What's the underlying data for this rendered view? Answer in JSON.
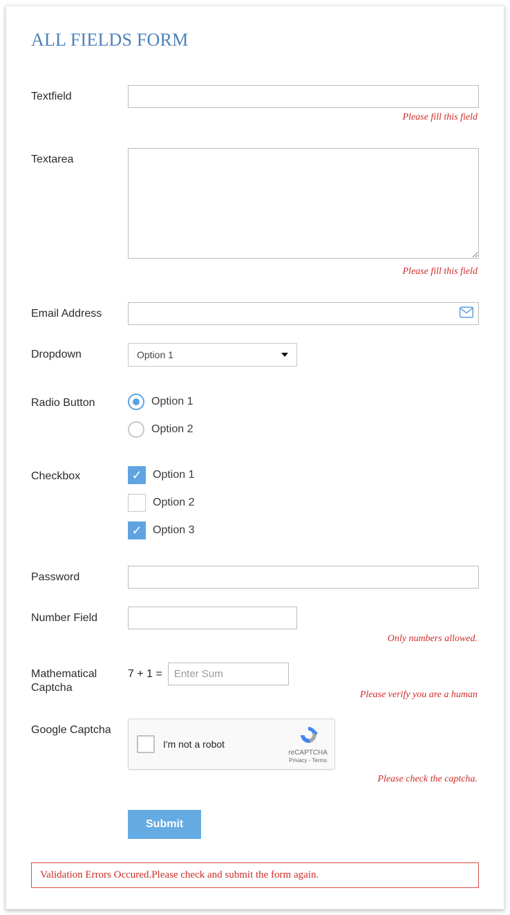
{
  "title": "ALL FIELDS FORM",
  "fields": {
    "textfield": {
      "label": "Textfield",
      "value": "",
      "error": "Please fill this field"
    },
    "textarea": {
      "label": "Textarea",
      "value": "",
      "error": "Please fill this field"
    },
    "email": {
      "label": "Email Address",
      "value": ""
    },
    "dropdown": {
      "label": "Dropdown",
      "selected": "Option 1"
    },
    "radio": {
      "label": "Radio Button",
      "options": [
        "Option 1",
        "Option 2"
      ],
      "selected_index": 0
    },
    "checkbox": {
      "label": "Checkbox",
      "options": [
        {
          "label": "Option 1",
          "checked": true
        },
        {
          "label": "Option 2",
          "checked": false
        },
        {
          "label": "Option 3",
          "checked": true
        }
      ]
    },
    "password": {
      "label": "Password",
      "value": ""
    },
    "number": {
      "label": "Number Field",
      "value": "",
      "error": "Only numbers allowed."
    },
    "mathcap": {
      "label": "Mathematical Captcha",
      "question": "7 + 1 =",
      "placeholder": "Enter Sum",
      "error": "Please verify you are a human"
    },
    "gcaptcha": {
      "label": "Google Captcha",
      "text": "I'm not a robot",
      "brand": "reCAPTCHA",
      "legal": "Privacy - Terms",
      "error": "Please check the captcha."
    }
  },
  "submit_label": "Submit",
  "global_error": "Validation Errors Occured.Please check and submit the form again."
}
